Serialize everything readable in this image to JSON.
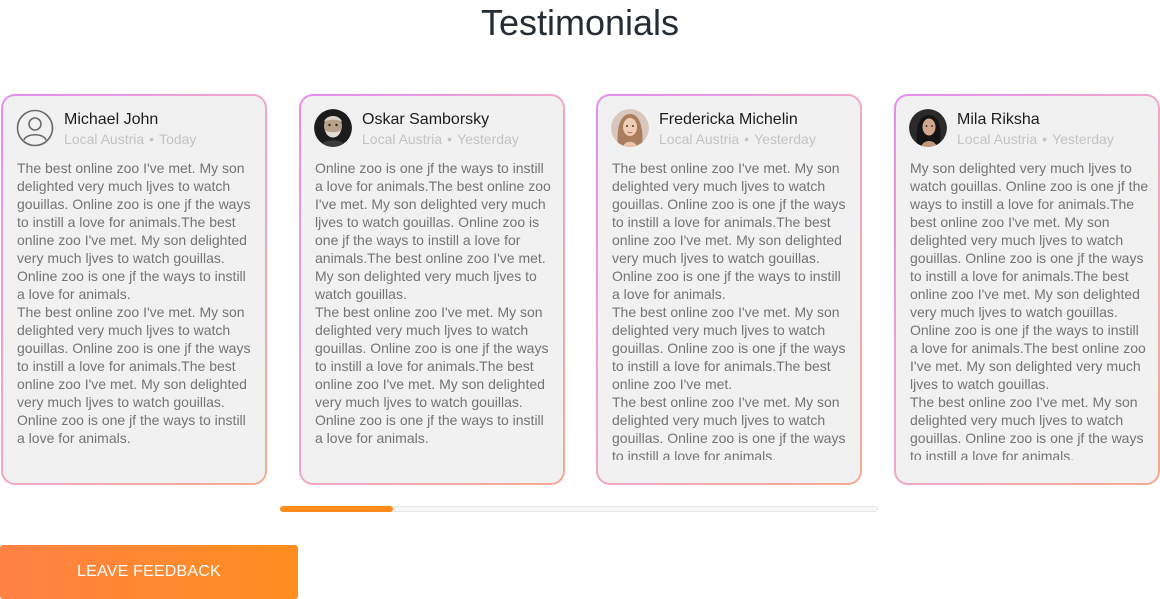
{
  "header": {
    "title": "Testimonials"
  },
  "testimonials": [
    {
      "name": "Michael John",
      "location": "Local Austria",
      "date": "Today",
      "avatar": "user-outline-icon",
      "paragraphs": [
        "The best online zoo I've met. My son delighted very much ljves to watch gouillas. Online zoo is one jf the ways to instill a love for animals.The best online zoo I've met. My son delighted very much ljves to watch gouillas. Online zoo is one jf the ways to instill a love for animals.",
        "The best online zoo I've met. My son delighted very much ljves to watch gouillas. Online zoo is one jf the ways to instill a love for animals.The best online zoo I've met. My son delighted very much ljves to watch gouillas. Online zoo is one jf the ways to instill a love for animals."
      ]
    },
    {
      "name": "Oskar Samborsky",
      "location": "Local Austria",
      "date": "Yesterday",
      "avatar": "older-man-photo",
      "paragraphs": [
        "Online zoo is one jf the ways to instill a love for animals.The best online zoo I've met. My son delighted very much ljves to watch gouillas. Online zoo is one jf the ways to instill a love for animals.The best online zoo I've met. My son delighted very much ljves to watch gouillas.",
        "The best online zoo I've met. My son delighted very much ljves to watch gouillas. Online zoo is one jf the ways to instill a love for animals.The best online zoo I've met. My son delighted very much ljves to watch gouillas. Online zoo is one jf the ways to instill a love for animals."
      ]
    },
    {
      "name": "Fredericka Michelin",
      "location": "Local Austria",
      "date": "Yesterday",
      "avatar": "woman-blonde-photo",
      "paragraphs": [
        "The best online zoo I've met. My son delighted very much ljves to watch gouillas. Online zoo is one jf the ways to instill a love for animals.The best online zoo I've met. My son delighted very much ljves to watch gouillas. Online zoo is one jf the ways to instill a love for animals.",
        "The best online zoo I've met. My son delighted very much ljves to watch gouillas. Online zoo is one jf the ways to instill a love for animals.The best online zoo I've met.",
        "The best online zoo I've met. My son delighted very much ljves to watch gouillas. Online zoo is one jf the ways to instill a love for animals."
      ]
    },
    {
      "name": "Mila Riksha",
      "location": "Local Austria",
      "date": "Yesterday",
      "avatar": "woman-dark-photo",
      "paragraphs": [
        "My son delighted very much ljves to watch gouillas. Online zoo is one jf the ways to instill a love for animals.The best online zoo I've met. My son delighted very much ljves to watch gouillas. Online zoo is one jf the ways to instill a love for animals.The best online zoo I've met. My son delighted very much ljves to watch gouillas. Online zoo is one jf the ways to instill a love for animals.The best online zoo I've met. My son delighted very much ljves to watch gouillas.",
        "The best online zoo I've met. My son delighted very much ljves to watch gouillas. Online zoo is one jf the ways to instill a love for animals."
      ]
    }
  ],
  "scrollbar": {
    "progress": 0.19,
    "color": "#ff8a1d"
  },
  "cta": {
    "label": "LEAVE FEEDBACK"
  },
  "colors": {
    "accent": "#ff8a1d",
    "card_background": "#f1f1f1",
    "card_border_gradient": [
      "#e58cf0",
      "#f6a98c"
    ],
    "title_text": "#262c34",
    "body_text": "#747474",
    "meta_text": "#c3c3c3"
  }
}
